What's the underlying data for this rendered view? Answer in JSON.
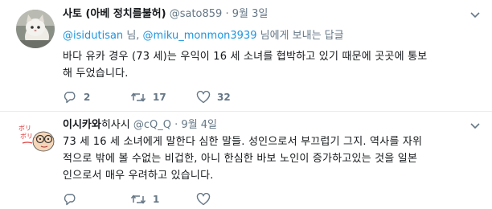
{
  "tweets": [
    {
      "name": "사토 (아베 정치를불허)",
      "handle": "@sato859",
      "separator": "·",
      "date": "9월 3일",
      "reply_mentions": [
        "@isidutisan",
        "@miku_monmon3939"
      ],
      "reply_joiner": " 님, ",
      "reply_suffix": " 님에게 보내는 답글",
      "body_lines": [
        "바다 유카 경우 (73 세)는 우익이 16 세 소녀를 협박하고 있기 때문에 곳곳에 통보",
        "해 두었습니다."
      ],
      "replies": "2",
      "retweets": "17",
      "likes": "32"
    },
    {
      "name": "이시카와",
      "name_suffix": "히사시",
      "handle": "@cQ_Q",
      "separator": "·",
      "date": "9월 4일",
      "avatar_text": "ボリ\nボリ…",
      "body_lines": [
        "73 세 16 세 소녀에게 말한다 심한 말들. 성인으로서 부끄럽기 그지. 역사를 자위",
        "적으로 밖에 볼 수없는 비겁한, 아니 한심한 바보 노인이 증가하고있는 것을 일본",
        "인으로서 매우 우려하고 있습니다."
      ],
      "replies": "",
      "retweets": "1",
      "likes": ""
    }
  ],
  "colors": {
    "link": "#1b95e0",
    "muted": "#657786",
    "text": "#14171a",
    "divider": "#e6ecf0"
  },
  "icons": [
    "reply-icon",
    "retweet-icon",
    "like-icon",
    "chevron-down-icon"
  ]
}
